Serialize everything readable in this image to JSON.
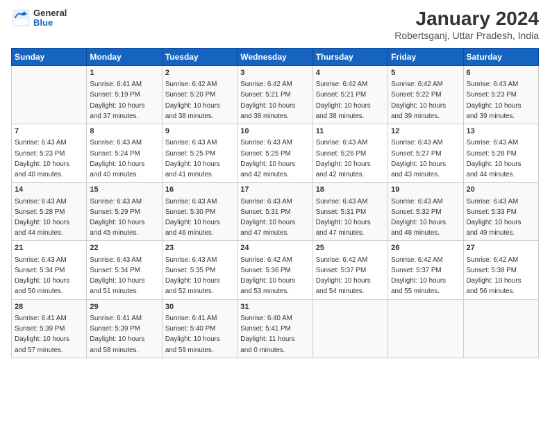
{
  "logo": {
    "general": "General",
    "blue": "Blue"
  },
  "title": "January 2024",
  "subtitle": "Robertsganj, Uttar Pradesh, India",
  "days_header": [
    "Sunday",
    "Monday",
    "Tuesday",
    "Wednesday",
    "Thursday",
    "Friday",
    "Saturday"
  ],
  "weeks": [
    [
      {
        "day": "",
        "info": ""
      },
      {
        "day": "1",
        "info": "Sunrise: 6:41 AM\nSunset: 5:19 PM\nDaylight: 10 hours\nand 37 minutes."
      },
      {
        "day": "2",
        "info": "Sunrise: 6:42 AM\nSunset: 5:20 PM\nDaylight: 10 hours\nand 38 minutes."
      },
      {
        "day": "3",
        "info": "Sunrise: 6:42 AM\nSunset: 5:21 PM\nDaylight: 10 hours\nand 38 minutes."
      },
      {
        "day": "4",
        "info": "Sunrise: 6:42 AM\nSunset: 5:21 PM\nDaylight: 10 hours\nand 38 minutes."
      },
      {
        "day": "5",
        "info": "Sunrise: 6:42 AM\nSunset: 5:22 PM\nDaylight: 10 hours\nand 39 minutes."
      },
      {
        "day": "6",
        "info": "Sunrise: 6:43 AM\nSunset: 5:23 PM\nDaylight: 10 hours\nand 39 minutes."
      }
    ],
    [
      {
        "day": "7",
        "info": "Sunrise: 6:43 AM\nSunset: 5:23 PM\nDaylight: 10 hours\nand 40 minutes."
      },
      {
        "day": "8",
        "info": "Sunrise: 6:43 AM\nSunset: 5:24 PM\nDaylight: 10 hours\nand 40 minutes."
      },
      {
        "day": "9",
        "info": "Sunrise: 6:43 AM\nSunset: 5:25 PM\nDaylight: 10 hours\nand 41 minutes."
      },
      {
        "day": "10",
        "info": "Sunrise: 6:43 AM\nSunset: 5:25 PM\nDaylight: 10 hours\nand 42 minutes."
      },
      {
        "day": "11",
        "info": "Sunrise: 6:43 AM\nSunset: 5:26 PM\nDaylight: 10 hours\nand 42 minutes."
      },
      {
        "day": "12",
        "info": "Sunrise: 6:43 AM\nSunset: 5:27 PM\nDaylight: 10 hours\nand 43 minutes."
      },
      {
        "day": "13",
        "info": "Sunrise: 6:43 AM\nSunset: 5:28 PM\nDaylight: 10 hours\nand 44 minutes."
      }
    ],
    [
      {
        "day": "14",
        "info": "Sunrise: 6:43 AM\nSunset: 5:28 PM\nDaylight: 10 hours\nand 44 minutes."
      },
      {
        "day": "15",
        "info": "Sunrise: 6:43 AM\nSunset: 5:29 PM\nDaylight: 10 hours\nand 45 minutes."
      },
      {
        "day": "16",
        "info": "Sunrise: 6:43 AM\nSunset: 5:30 PM\nDaylight: 10 hours\nand 46 minutes."
      },
      {
        "day": "17",
        "info": "Sunrise: 6:43 AM\nSunset: 5:31 PM\nDaylight: 10 hours\nand 47 minutes."
      },
      {
        "day": "18",
        "info": "Sunrise: 6:43 AM\nSunset: 5:31 PM\nDaylight: 10 hours\nand 47 minutes."
      },
      {
        "day": "19",
        "info": "Sunrise: 6:43 AM\nSunset: 5:32 PM\nDaylight: 10 hours\nand 48 minutes."
      },
      {
        "day": "20",
        "info": "Sunrise: 6:43 AM\nSunset: 5:33 PM\nDaylight: 10 hours\nand 49 minutes."
      }
    ],
    [
      {
        "day": "21",
        "info": "Sunrise: 6:43 AM\nSunset: 5:34 PM\nDaylight: 10 hours\nand 50 minutes."
      },
      {
        "day": "22",
        "info": "Sunrise: 6:43 AM\nSunset: 5:34 PM\nDaylight: 10 hours\nand 51 minutes."
      },
      {
        "day": "23",
        "info": "Sunrise: 6:43 AM\nSunset: 5:35 PM\nDaylight: 10 hours\nand 52 minutes."
      },
      {
        "day": "24",
        "info": "Sunrise: 6:42 AM\nSunset: 5:36 PM\nDaylight: 10 hours\nand 53 minutes."
      },
      {
        "day": "25",
        "info": "Sunrise: 6:42 AM\nSunset: 5:37 PM\nDaylight: 10 hours\nand 54 minutes."
      },
      {
        "day": "26",
        "info": "Sunrise: 6:42 AM\nSunset: 5:37 PM\nDaylight: 10 hours\nand 55 minutes."
      },
      {
        "day": "27",
        "info": "Sunrise: 6:42 AM\nSunset: 5:38 PM\nDaylight: 10 hours\nand 56 minutes."
      }
    ],
    [
      {
        "day": "28",
        "info": "Sunrise: 6:41 AM\nSunset: 5:39 PM\nDaylight: 10 hours\nand 57 minutes."
      },
      {
        "day": "29",
        "info": "Sunrise: 6:41 AM\nSunset: 5:39 PM\nDaylight: 10 hours\nand 58 minutes."
      },
      {
        "day": "30",
        "info": "Sunrise: 6:41 AM\nSunset: 5:40 PM\nDaylight: 10 hours\nand 59 minutes."
      },
      {
        "day": "31",
        "info": "Sunrise: 6:40 AM\nSunset: 5:41 PM\nDaylight: 11 hours\nand 0 minutes."
      },
      {
        "day": "",
        "info": ""
      },
      {
        "day": "",
        "info": ""
      },
      {
        "day": "",
        "info": ""
      }
    ]
  ]
}
